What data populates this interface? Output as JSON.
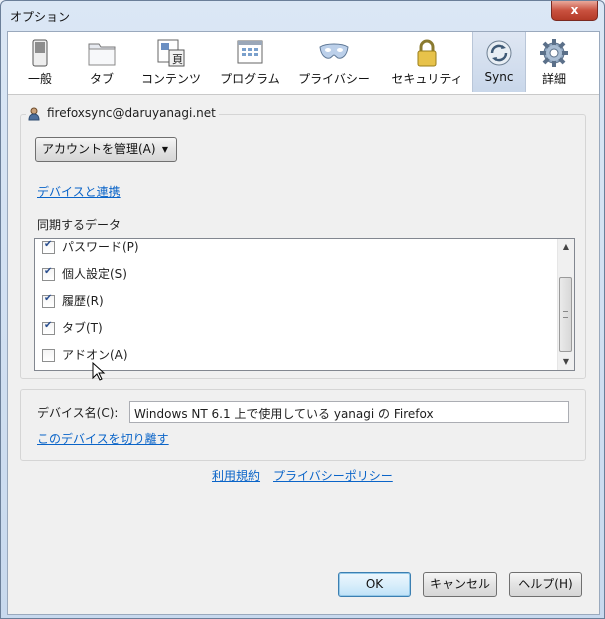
{
  "window": {
    "title": "オプション",
    "close_label": "x"
  },
  "toolbar": {
    "items": [
      {
        "label": "一般",
        "icon": "switch-icon"
      },
      {
        "label": "タブ",
        "icon": "folder-tabs-icon"
      },
      {
        "label": "コンテンツ",
        "icon": "content-page-icon"
      },
      {
        "label": "プログラム",
        "icon": "program-window-icon"
      },
      {
        "label": "プライバシー",
        "icon": "mask-icon"
      },
      {
        "label": "セキュリティ",
        "icon": "padlock-icon"
      },
      {
        "label": "Sync",
        "icon": "sync-icon",
        "selected": true
      },
      {
        "label": "詳細",
        "icon": "gear-icon"
      }
    ]
  },
  "account": {
    "email": "firefoxsync@daruyanagi.net",
    "manage_button": "アカウントを管理(A)",
    "devices_link": "デバイスと連携"
  },
  "sync_data": {
    "heading": "同期するデータ",
    "items": [
      {
        "label": "パスワード(P)",
        "checked": true
      },
      {
        "label": "個人設定(S)",
        "checked": true
      },
      {
        "label": "履歴(R)",
        "checked": true
      },
      {
        "label": "タブ(T)",
        "checked": true
      },
      {
        "label": "アドオン(A)",
        "checked": false
      }
    ]
  },
  "device": {
    "label": "デバイス名(C):",
    "value": "Windows NT 6.1 上で使用している yanagi の Firefox",
    "disconnect_link": "このデバイスを切り離す"
  },
  "footer": {
    "terms_link": "利用規約",
    "privacy_link": "プライバシーポリシー"
  },
  "buttons": {
    "ok": "OK",
    "cancel": "キャンセル",
    "help": "ヘルプ(H)"
  }
}
